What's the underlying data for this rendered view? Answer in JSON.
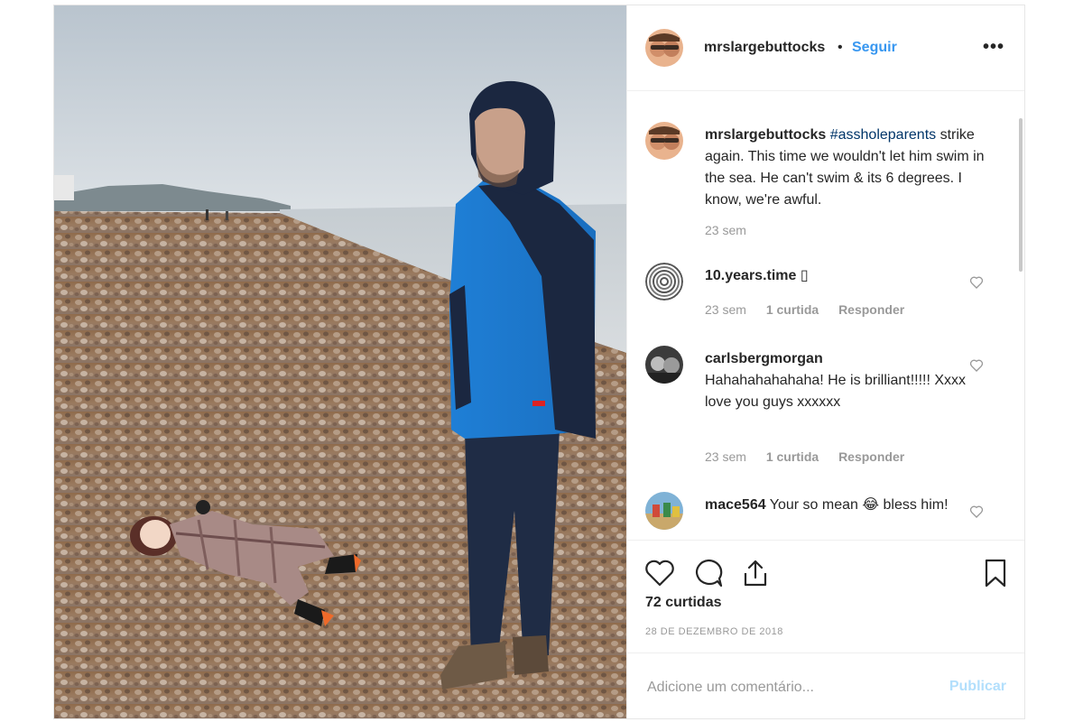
{
  "header": {
    "username": "mrslargebuttocks",
    "separator": "•",
    "follow_label": "Seguir",
    "more_label": "•••"
  },
  "caption": {
    "username": "mrslargebuttocks",
    "hashtag": "#assholeparents",
    "text": "strike again. This time we wouldn't let him swim in the sea. He can't swim & its 6 degrees. I know, we're awful.",
    "time": "23 sem"
  },
  "comments": [
    {
      "username": "10.years.time",
      "text": "",
      "emoji": "▯",
      "time": "23 sem",
      "likes": "1 curtida",
      "reply": "Responder"
    },
    {
      "username": "carlsbergmorgan",
      "text": "Hahahahahahaha! He is brilliant!!!!! Xxxx love you guys xxxxxx",
      "time": "23 sem",
      "likes": "1 curtida",
      "reply": "Responder"
    },
    {
      "username": "mace564",
      "text": "Your so mean 😂 bless him!"
    }
  ],
  "likes_count": "72 curtidas",
  "date": "28 DE DEZEMBRO DE 2018",
  "add_comment": {
    "placeholder": "Adicione um comentário...",
    "publish_label": "Publicar"
  },
  "colors": {
    "link": "#3897f0",
    "hashtag": "#003569",
    "muted": "#999999",
    "publish_disabled": "#b2dffc"
  }
}
